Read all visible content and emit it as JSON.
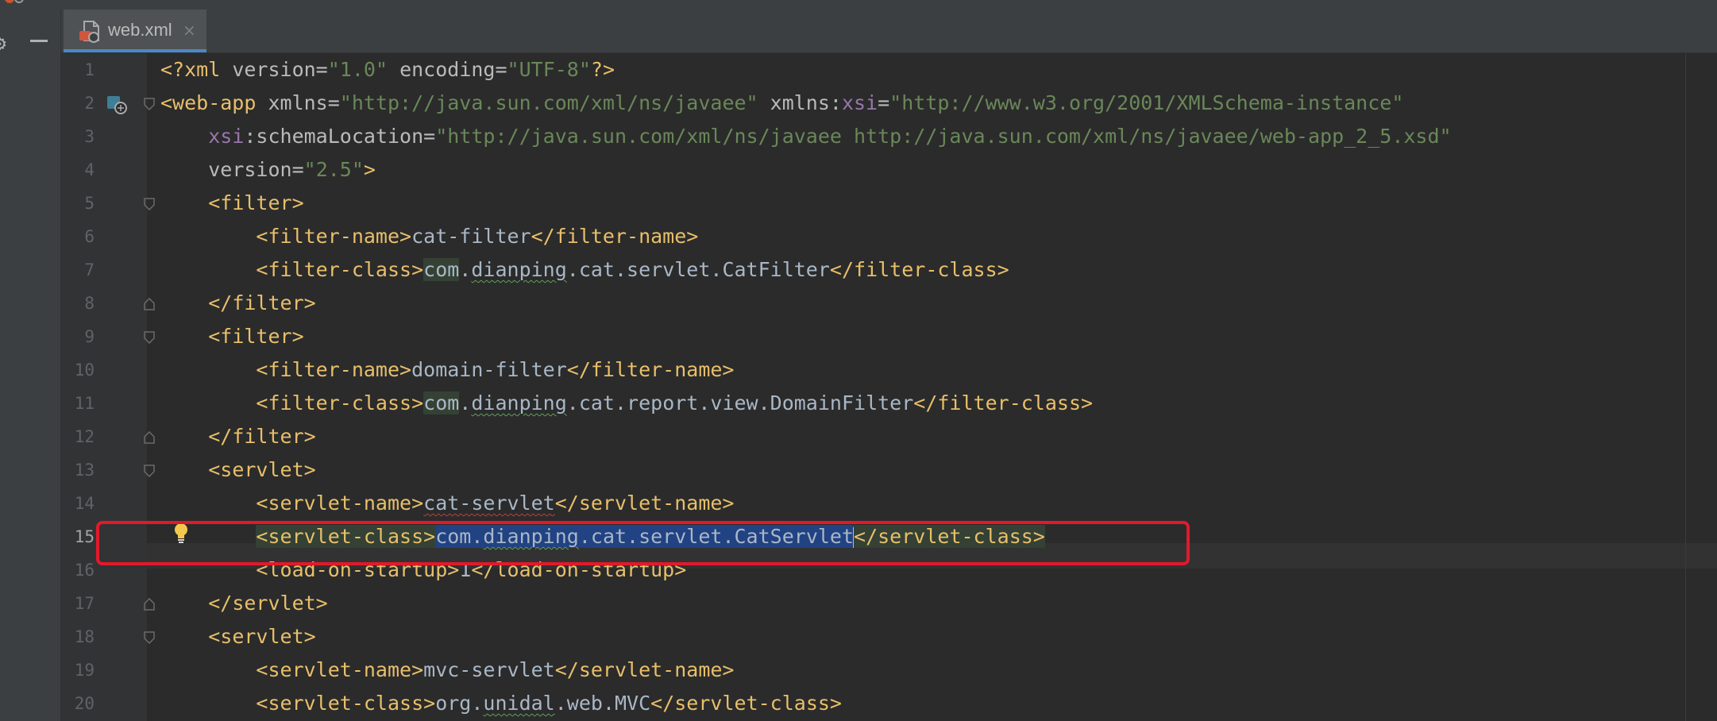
{
  "tab": {
    "label": "web.xml",
    "close_glyph": "×",
    "icon": "xml-file-icon"
  },
  "toolbar": {
    "gear_icon": "gear-icon",
    "collapse_icon": "minus-icon"
  },
  "editor": {
    "current_line": 15,
    "line_numbers": [
      "1",
      "2",
      "3",
      "4",
      "5",
      "6",
      "7",
      "8",
      "9",
      "10",
      "11",
      "12",
      "13",
      "14",
      "15",
      "16",
      "17",
      "18",
      "19",
      "20"
    ],
    "lines": {
      "l1": {
        "p1": "<?xml ",
        "p2": "version",
        "p3": "=",
        "p4": "\"1.0\"",
        "p5": " ",
        "p6": "encoding",
        "p7": "=",
        "p8": "\"UTF-8\"",
        "p9": "?>"
      },
      "l2": {
        "p1": "<web-app ",
        "p2": "xmlns",
        "p3": "=",
        "p4": "\"http://java.sun.com/xml/ns/javaee\"",
        "p5": " xmlns:",
        "p6": "xsi",
        "p7": "=",
        "p8": "\"http://www.w3.org/2001/XMLSchema-instance\""
      },
      "l3": {
        "p0": "    ",
        "p1": "xsi",
        "p2": ":schemaLocation",
        "p3": "=",
        "p4": "\"http://java.sun.com/xml/ns/javaee http://java.sun.com/xml/ns/javaee/web-app_2_5.xsd\""
      },
      "l4": {
        "p0": "    ",
        "p1": "version",
        "p2": "=",
        "p3": "\"2.5\"",
        "p4": ">"
      },
      "l5": {
        "p0": "    ",
        "p1": "<filter>"
      },
      "l6": {
        "p0": "        ",
        "p1": "<filter-name>",
        "p2": "cat-filter",
        "p3": "</filter-name>"
      },
      "l7": {
        "p0": "        ",
        "p1": "<filter-class>",
        "p2": "com",
        "p3": ".",
        "p4": "dianping",
        "p5": ".cat.servlet.CatFilter",
        "p6": "</filter-class>"
      },
      "l8": {
        "p0": "    ",
        "p1": "</filter>"
      },
      "l9": {
        "p0": "    ",
        "p1": "<filter>"
      },
      "l10": {
        "p0": "        ",
        "p1": "<filter-name>",
        "p2": "domain-filter",
        "p3": "</filter-name>"
      },
      "l11": {
        "p0": "        ",
        "p1": "<filter-class>",
        "p2": "com",
        "p3": ".",
        "p4": "dianping",
        "p5": ".cat.report.view.DomainFilter",
        "p6": "</filter-class>"
      },
      "l12": {
        "p0": "    ",
        "p1": "</filter>"
      },
      "l13": {
        "p0": "    ",
        "p1": "<servlet>"
      },
      "l14": {
        "p0": "        ",
        "p1": "<servlet-name>",
        "p2": "cat-servlet",
        "p3": "</servlet-name>"
      },
      "l15": {
        "p0": "        ",
        "p1": "<servlet-class>",
        "p2": "com.",
        "p3": "dianping",
        "p4": ".cat.servlet.CatServlet",
        "p5": "</servlet-class>"
      },
      "l16": {
        "p0": "        ",
        "p1": "<load-on-startup>",
        "p2": "1",
        "p3": "</load-on-startup>"
      },
      "l17": {
        "p0": "    ",
        "p1": "</servlet>"
      },
      "l18": {
        "p0": "    ",
        "p1": "<servlet>"
      },
      "l19": {
        "p0": "        ",
        "p1": "<servlet-name>",
        "p2": "mvc-servlet",
        "p3": "</servlet-name>"
      },
      "l20": {
        "p0": "        ",
        "p1": "<servlet-class>",
        "p2": "org.",
        "p3": "unidal",
        "p4": ".web.MVC",
        "p5": "</servlet-class>"
      }
    }
  },
  "highlight": {
    "color": "#e3192b",
    "annotates_line": 15
  },
  "colors": {
    "tag": "#e8bf6a",
    "attr_value": "#6a8759",
    "text": "#a9b7c6",
    "namespace": "#9876aa",
    "selection": "#214283",
    "tab_accent": "#4a88c7"
  }
}
